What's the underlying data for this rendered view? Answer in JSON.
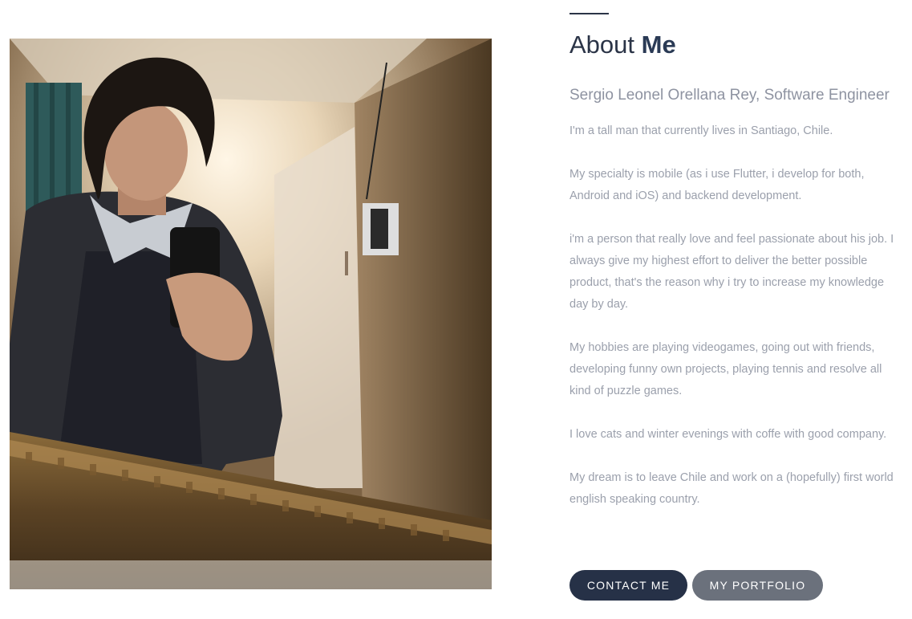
{
  "about": {
    "heading_light": "About ",
    "heading_bold": "Me",
    "subtitle": "Sergio Leonel Orellana Rey, Software Engineer",
    "paragraphs": [
      "I'm a tall man that currently lives in Santiago, Chile.",
      "My specialty is mobile (as i use Flutter, i develop for both, Android and iOS) and backend development.",
      "i'm a person that really love and feel passionate about his job. I always give my highest effort to deliver the better possible product, that's the reason why i try to increase my knowledge day by day.",
      "My hobbies are playing videogames, going out with friends, developing funny own projects, playing tennis and resolve all kind of puzzle games.",
      "I love cats and winter evenings with coffe with good company.",
      "My dream is to leave Chile and work on a (hopefully) first world english speaking country."
    ]
  },
  "buttons": {
    "contact_label": "CONTACT ME",
    "portfolio_label": "MY PORTFOLIO"
  },
  "colors": {
    "heading": "#2b3447",
    "body_text": "#9ba0ac",
    "contact_button": "#263147",
    "portfolio_button": "#6b717c"
  }
}
